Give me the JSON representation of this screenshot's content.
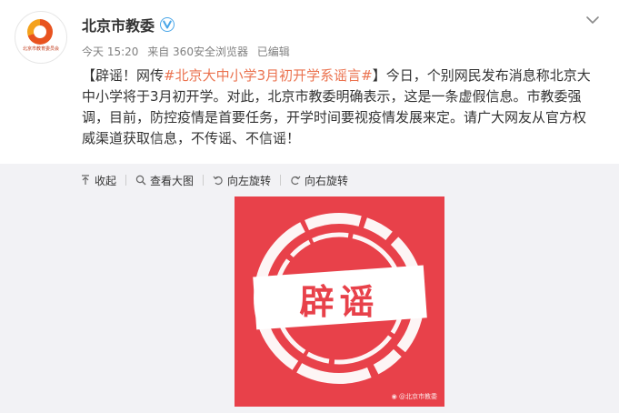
{
  "post": {
    "avatar_logo_text": "北京市教育委员会",
    "author": "北京市教委",
    "meta": {
      "time": "今天 15:20",
      "source": "来自 360安全浏览器",
      "edited": "已编辑"
    },
    "body": {
      "prefix": "【辟谣！网传",
      "topic": "#北京大中小学3月初开学系谣言#",
      "rest": "】今日，个别网民发布消息称北京大中小学将于3月初开学。对此，北京市教委明确表示，这是一条虚假信息。市教委强调，目前，防控疫情是首要任务，开学时间要视疫情发展来定。请广大网友从官方权威渠道获取信息，不传谣、不信谣！"
    },
    "actions": {
      "collapse": "收起",
      "view_large": "查看大图",
      "rotate_left": "向左旋转",
      "rotate_right": "向右旋转"
    },
    "image": {
      "stamp_text": "辟谣",
      "watermark": "@北京市教委"
    }
  },
  "colors": {
    "topic": "#eb7350",
    "stamp_red": "#e8414a",
    "verified": "#ffa500"
  },
  "icons": [
    "verified-icon",
    "chevron-down-icon",
    "collapse-icon",
    "zoom-icon",
    "rotate-left-icon",
    "rotate-right-icon",
    "weibo-icon"
  ]
}
